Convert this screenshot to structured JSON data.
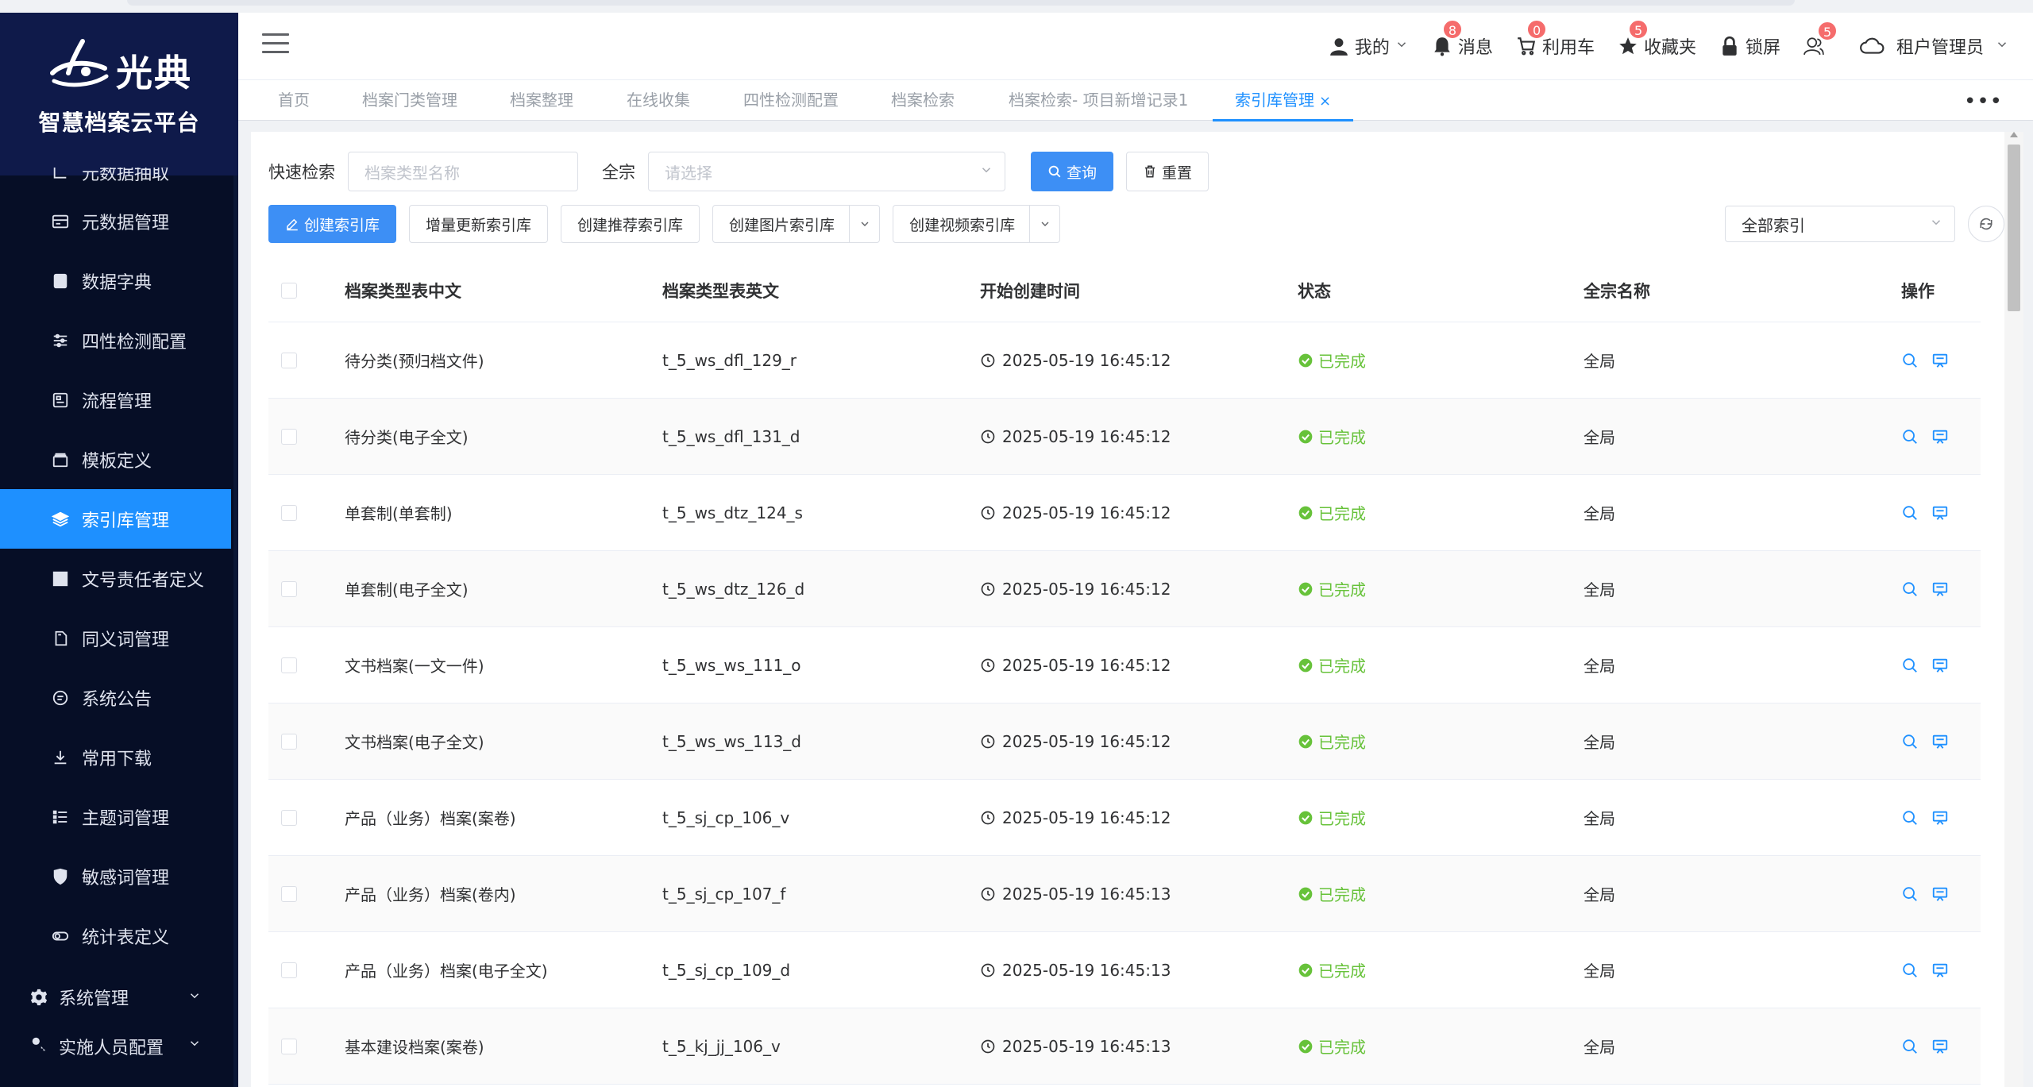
{
  "brand": {
    "logo_text": "光典",
    "platform_name": "智慧档案云平台"
  },
  "sidebar": {
    "clipped_item": "元数据抽取",
    "items": [
      {
        "label": "元数据管理",
        "icon": "card-icon"
      },
      {
        "label": "数据字典",
        "icon": "book-icon"
      },
      {
        "label": "四性检测配置",
        "icon": "sliders-icon"
      },
      {
        "label": "流程管理",
        "icon": "flow-icon"
      },
      {
        "label": "模板定义",
        "icon": "box-icon"
      },
      {
        "label": "索引库管理",
        "icon": "layers-icon",
        "active": true
      },
      {
        "label": "文号责任者定义",
        "icon": "grid-icon"
      },
      {
        "label": "同义词管理",
        "icon": "copy-icon"
      },
      {
        "label": "系统公告",
        "icon": "chat-icon"
      },
      {
        "label": "常用下载",
        "icon": "download-icon"
      },
      {
        "label": "主题词管理",
        "icon": "list-icon"
      },
      {
        "label": "敏感词管理",
        "icon": "shield-icon"
      },
      {
        "label": "统计表定义",
        "icon": "toggle-icon"
      }
    ],
    "groups": [
      {
        "label": "系统管理",
        "icon": "gear-icon"
      },
      {
        "label": "实施人员配置",
        "icon": "key-icon"
      }
    ]
  },
  "header": {
    "user_menu": "我的",
    "messages": {
      "label": "消息",
      "badge": "8"
    },
    "cart": {
      "label": "利用车",
      "badge": "0"
    },
    "favorites": {
      "label": "收藏夹",
      "badge": "5"
    },
    "lock": {
      "label": "锁屏"
    },
    "users_badge": "5",
    "tenant": "租户管理员"
  },
  "tabs": [
    {
      "label": "首页"
    },
    {
      "label": "档案门类管理"
    },
    {
      "label": "档案整理"
    },
    {
      "label": "在线收集"
    },
    {
      "label": "四性检测配置"
    },
    {
      "label": "档案检索"
    },
    {
      "label": "档案检索- 项目新增记录1"
    },
    {
      "label": "索引库管理",
      "active": true,
      "close": "×"
    }
  ],
  "search": {
    "quick_label": "快速检索",
    "quick_placeholder": "档案类型名称",
    "scope_label": "全宗",
    "scope_placeholder": "请选择",
    "query_button": "查询",
    "reset_button": "重置"
  },
  "actions": {
    "create": "创建索引库",
    "incremental": "增量更新索引库",
    "recommend": "创建推荐索引库",
    "image": "创建图片索引库",
    "video": "创建视频索引库",
    "filter_value": "全部索引"
  },
  "table": {
    "columns": [
      "档案类型表中文",
      "档案类型表英文",
      "开始创建时间",
      "状态",
      "全宗名称",
      "操作"
    ],
    "rows": [
      {
        "cn": "待分类(预归档文件)",
        "en": "t_5_ws_dfl_129_r",
        "time": "2025-05-19 16:45:12",
        "status": "已完成",
        "scope": "全局"
      },
      {
        "cn": "待分类(电子全文)",
        "en": "t_5_ws_dfl_131_d",
        "time": "2025-05-19 16:45:12",
        "status": "已完成",
        "scope": "全局"
      },
      {
        "cn": "单套制(单套制)",
        "en": "t_5_ws_dtz_124_s",
        "time": "2025-05-19 16:45:12",
        "status": "已完成",
        "scope": "全局"
      },
      {
        "cn": "单套制(电子全文)",
        "en": "t_5_ws_dtz_126_d",
        "time": "2025-05-19 16:45:12",
        "status": "已完成",
        "scope": "全局"
      },
      {
        "cn": "文书档案(一文一件)",
        "en": "t_5_ws_ws_111_o",
        "time": "2025-05-19 16:45:12",
        "status": "已完成",
        "scope": "全局"
      },
      {
        "cn": "文书档案(电子全文)",
        "en": "t_5_ws_ws_113_d",
        "time": "2025-05-19 16:45:12",
        "status": "已完成",
        "scope": "全局"
      },
      {
        "cn": "产品（业务）档案(案卷)",
        "en": "t_5_sj_cp_106_v",
        "time": "2025-05-19 16:45:12",
        "status": "已完成",
        "scope": "全局"
      },
      {
        "cn": "产品（业务）档案(卷内)",
        "en": "t_5_sj_cp_107_f",
        "time": "2025-05-19 16:45:13",
        "status": "已完成",
        "scope": "全局"
      },
      {
        "cn": "产品（业务）档案(电子全文)",
        "en": "t_5_sj_cp_109_d",
        "time": "2025-05-19 16:45:13",
        "status": "已完成",
        "scope": "全局"
      },
      {
        "cn": "基本建设档案(案卷)",
        "en": "t_5_kj_jj_106_v",
        "time": "2025-05-19 16:45:13",
        "status": "已完成",
        "scope": "全局"
      }
    ]
  },
  "colors": {
    "primary": "#1e90ff",
    "sidebar_bg": "#060e26",
    "success": "#67c23a",
    "badge": "#f56c6c"
  }
}
